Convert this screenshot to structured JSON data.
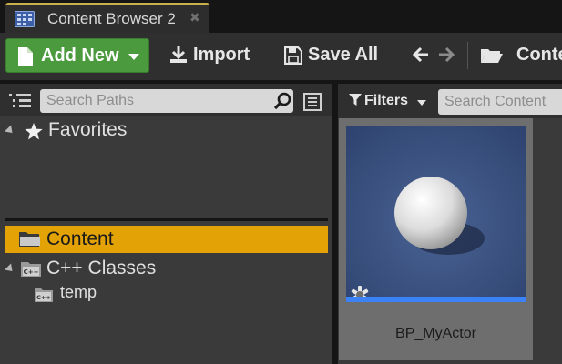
{
  "tab": {
    "title": "Content Browser 2",
    "icon": "content-browser-icon",
    "close_glyph": "✖",
    "accent": "#c9b04a"
  },
  "toolbar": {
    "add_new_label": "Add New",
    "add_new_color": "#4c9a3e",
    "import_label": "Import",
    "save_all_label": "Save All",
    "breadcrumb_label": "Content"
  },
  "sources": {
    "search_placeholder": "Search Paths",
    "favorites_label": "Favorites",
    "items": [
      {
        "label": "Content",
        "icon": "folder-icon",
        "selected": true
      },
      {
        "label": "C++ Classes",
        "icon": "cpp-folder-icon",
        "selected": false
      },
      {
        "label": "temp",
        "icon": "cpp-folder-icon",
        "selected": false
      }
    ],
    "selected_color": "#e3a306"
  },
  "content": {
    "filters_label": "Filters",
    "search_placeholder": "Search Content",
    "assets": [
      {
        "name": "BP_MyActor",
        "type_color": "#3b82f6"
      }
    ]
  }
}
